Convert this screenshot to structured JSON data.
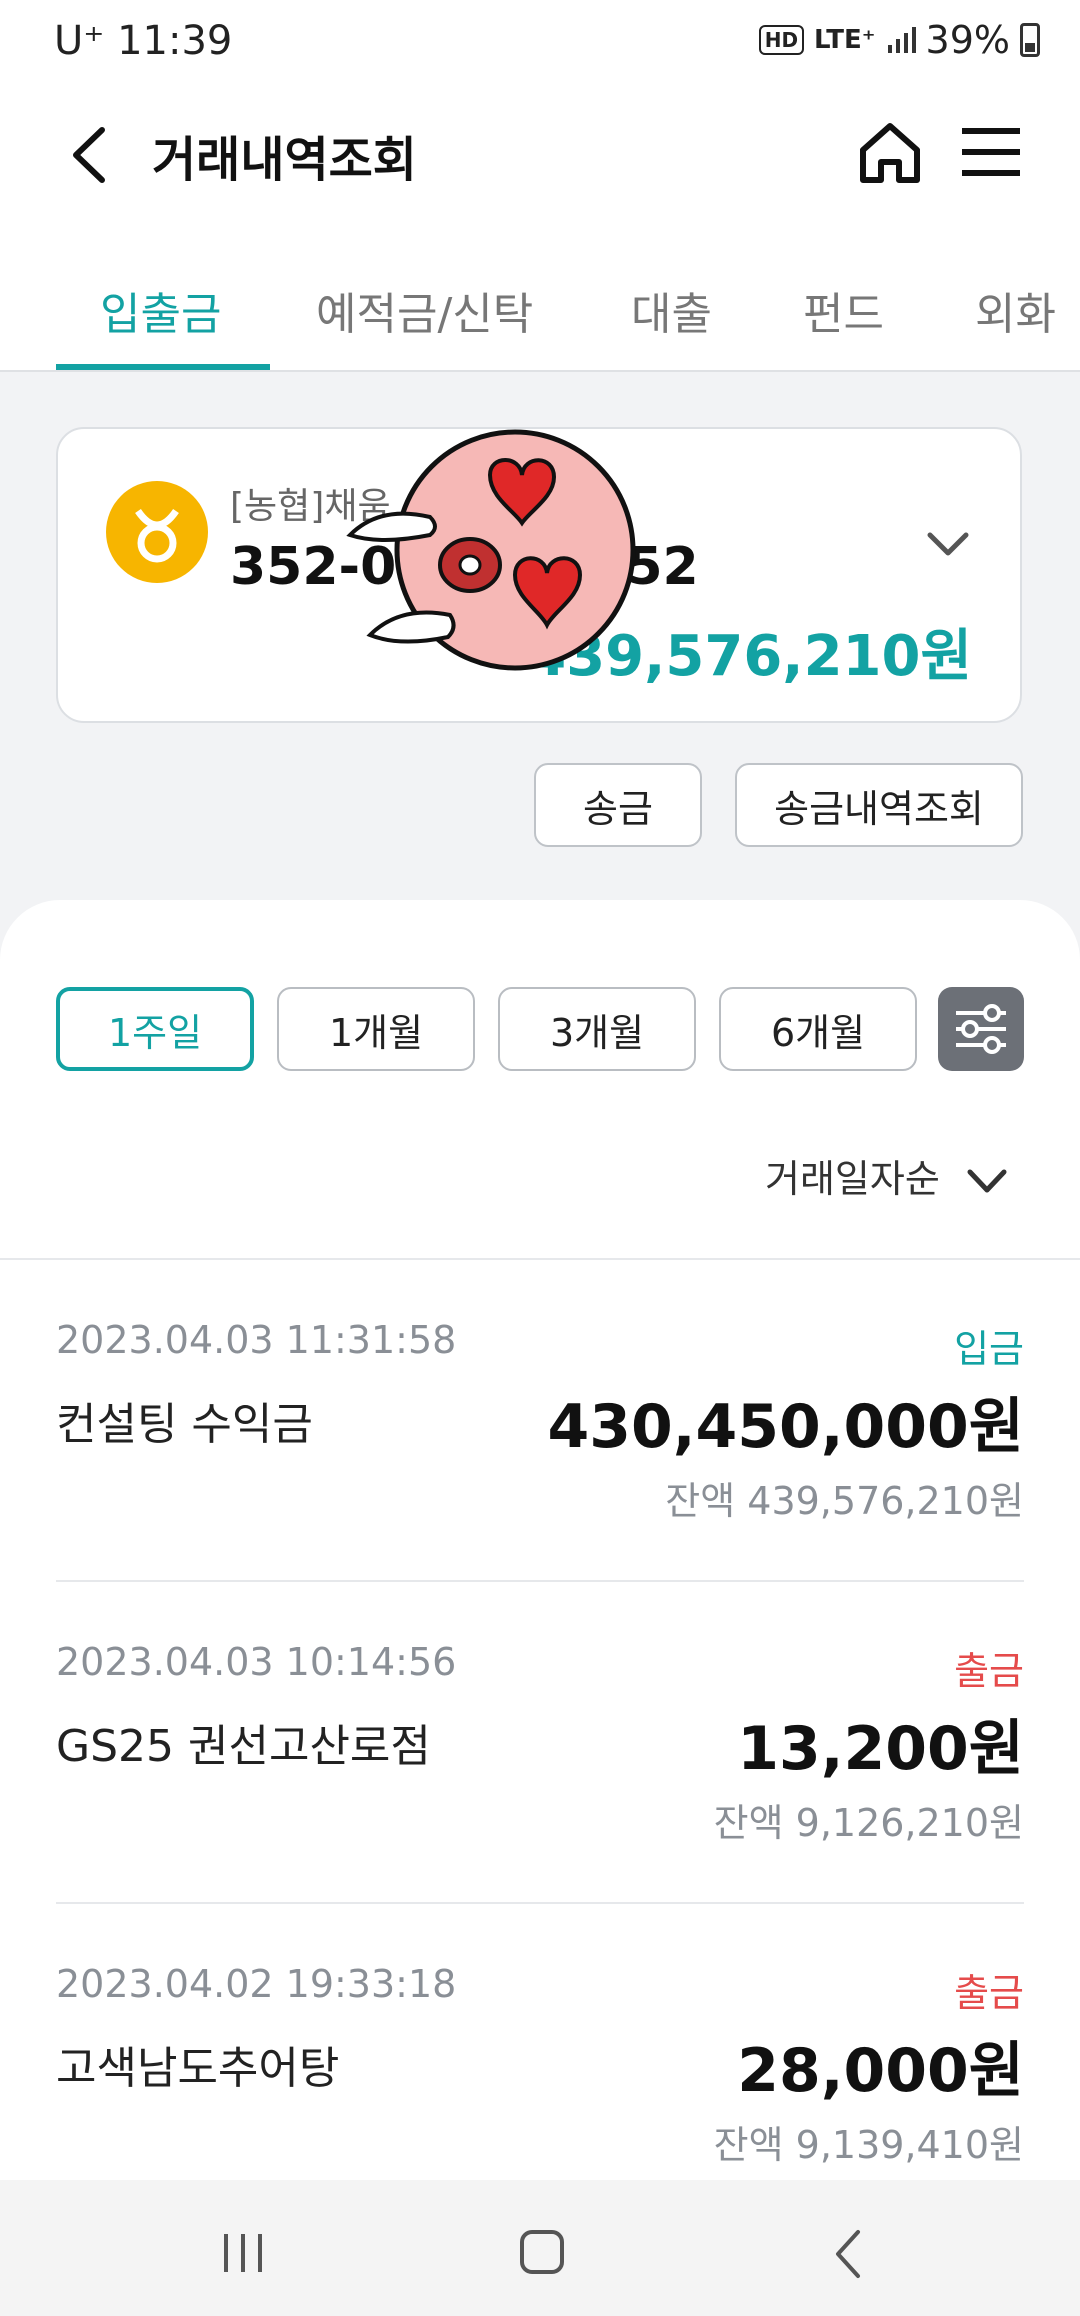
{
  "status_bar": {
    "carrier_time": "U⁺ 11:39",
    "hd": "HD",
    "network": "LTE⁺",
    "battery": "39%"
  },
  "header": {
    "title": "거래내역조회",
    "icons": [
      "back-arrow-icon",
      "home-icon",
      "hamburger-menu-icon"
    ]
  },
  "tabs": [
    {
      "label": "입출금",
      "active": true
    },
    {
      "label": "예적금/신탁",
      "active": false
    },
    {
      "label": "대출",
      "active": false
    },
    {
      "label": "펀드",
      "active": false
    },
    {
      "label": "외화",
      "active": false
    }
  ],
  "account": {
    "name": "[농협]채움",
    "number": "352-0",
    "number_tail": "52",
    "balance": "439,576,210원",
    "brand_color": "#f7b500"
  },
  "actions": {
    "transfer": "송금",
    "transfer_history": "송금내역조회"
  },
  "periods": [
    {
      "label": "1주일",
      "active": true
    },
    {
      "label": "1개월",
      "active": false
    },
    {
      "label": "3개월",
      "active": false
    },
    {
      "label": "6개월",
      "active": false
    }
  ],
  "sort": {
    "label": "거래일자순"
  },
  "transactions": [
    {
      "datetime": "2023.04.03 11:31:58",
      "type": "입금",
      "description": "컨설팅 수익금",
      "amount": "430,450,000원",
      "balance": "잔액 439,576,210원"
    },
    {
      "datetime": "2023.04.03 10:14:56",
      "type": "출금",
      "description": "GS25 권선고산로점",
      "amount": "13,200원",
      "balance": "잔액 9,126,210원"
    },
    {
      "datetime": "2023.04.02 19:33:18",
      "type": "출금",
      "description": "고색남도추어탕",
      "amount": "28,000원",
      "balance": "잔액 9,139,410원"
    }
  ],
  "colors": {
    "accent": "#13a2a3",
    "withdrawal": "#e54b4b",
    "deposit": "#13a2a3"
  }
}
